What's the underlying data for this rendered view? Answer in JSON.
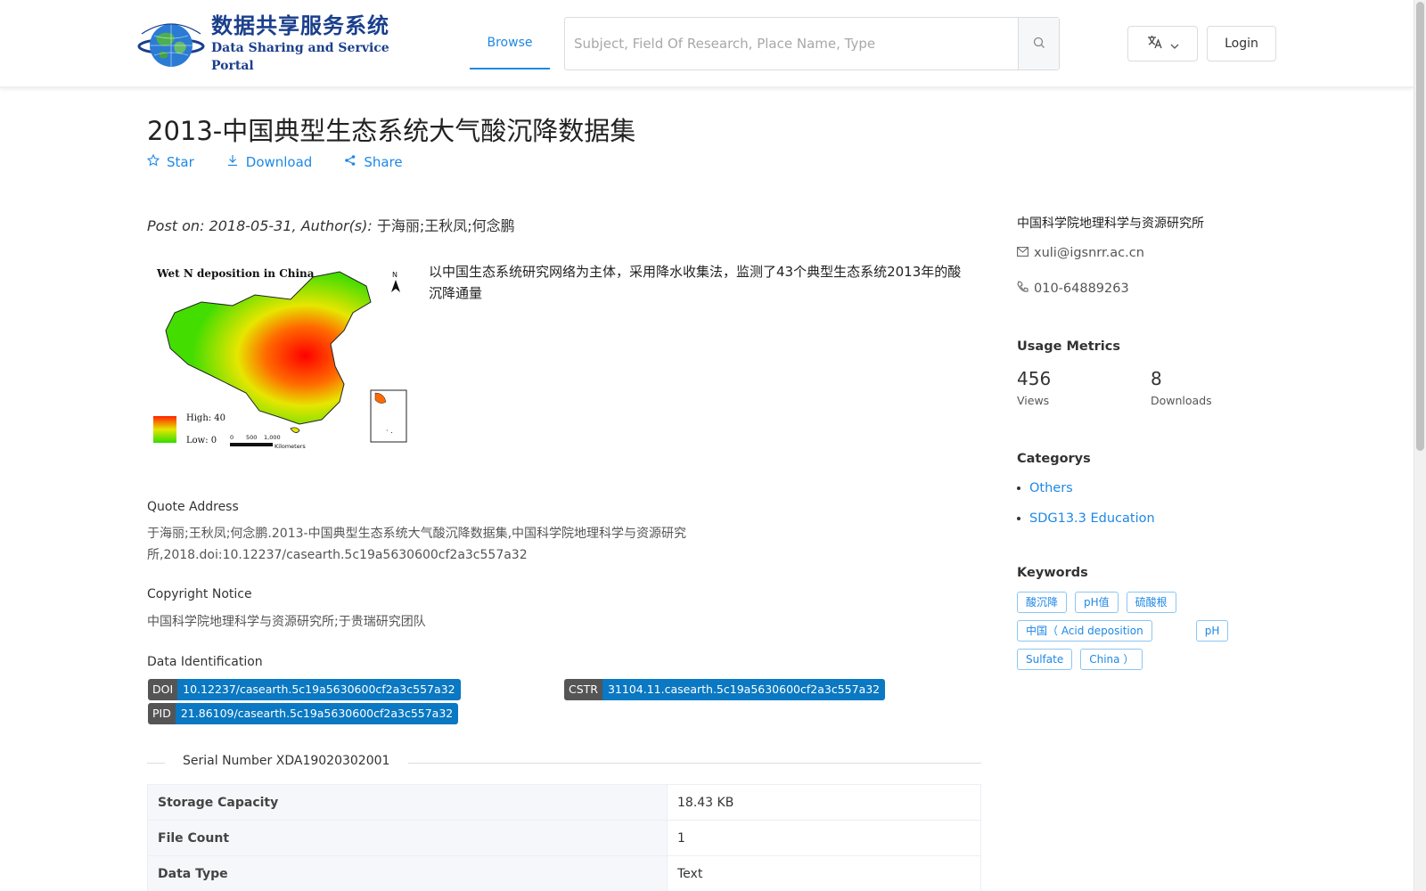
{
  "header": {
    "logo_cn": "数据共享服务系统",
    "logo_en": "Data Sharing and Service Portal",
    "nav_browse": "Browse",
    "search_placeholder": "Subject, Field Of Research, Place Name, Type",
    "login_label": "Login"
  },
  "dataset": {
    "title": "2013-中国典型生态系统大气酸沉降数据集",
    "actions": {
      "star": "Star",
      "download": "Download",
      "share": "Share"
    },
    "post_prefix": "Post on: 2018-05-31, Author(s): ",
    "authors": "于海丽;王秋凤;何念鹏",
    "summary": "以中国生态系统研究网络为主体，采用降水收集法，监测了43个典型生态系统2013年的酸沉降通量",
    "thumbnail": {
      "title": "Wet N deposition in China",
      "legend_high": "High: 40",
      "legend_low": "Low: 0",
      "scale_labels": [
        "0",
        "500",
        "1,000"
      ],
      "scale_unit": "Kilometers",
      "north": "N"
    }
  },
  "quote": {
    "label": "Quote Address",
    "text": "于海丽;王秋凤;何念鹏.2013-中国典型生态系统大气酸沉降数据集,中国科学院地理科学与资源研究所,2018.doi:10.12237/casearth.5c19a5630600cf2a3c557a32"
  },
  "copyright": {
    "label": "Copyright Notice",
    "text": "中国科学院地理科学与资源研究所;于贵瑞研究团队"
  },
  "identification": {
    "label": "Data Identification",
    "doi_key": "DOI",
    "doi": "10.12237/casearth.5c19a5630600cf2a3c557a32",
    "cstr_key": "CSTR",
    "cstr": "31104.11.casearth.5c19a5630600cf2a3c557a32",
    "pid_key": "PID",
    "pid": "21.86109/casearth.5c19a5630600cf2a3c557a32"
  },
  "serial": "Serial Number XDA19020302001",
  "table": [
    {
      "key": "Storage Capacity",
      "value": "18.43 KB"
    },
    {
      "key": "File Count",
      "value": "1"
    },
    {
      "key": "Data Type",
      "value": "Text"
    }
  ],
  "sidebar": {
    "org": "中国科学院地理科学与资源研究所",
    "email": "xuli@igsnrr.ac.cn",
    "phone": "010-64889263",
    "usage_title": "Usage Metrics",
    "views_value": "456",
    "views_label": "Views",
    "downloads_value": "8",
    "downloads_label": "Downloads",
    "categories_title": "Categorys",
    "categories": [
      "Others",
      "SDG13.3 Education"
    ],
    "keywords_title": "Keywords",
    "keywords": [
      "酸沉降",
      "pH值",
      "硫酸根",
      "中国（ Acid deposition",
      "pH",
      "Sulfate",
      "China ）"
    ]
  }
}
